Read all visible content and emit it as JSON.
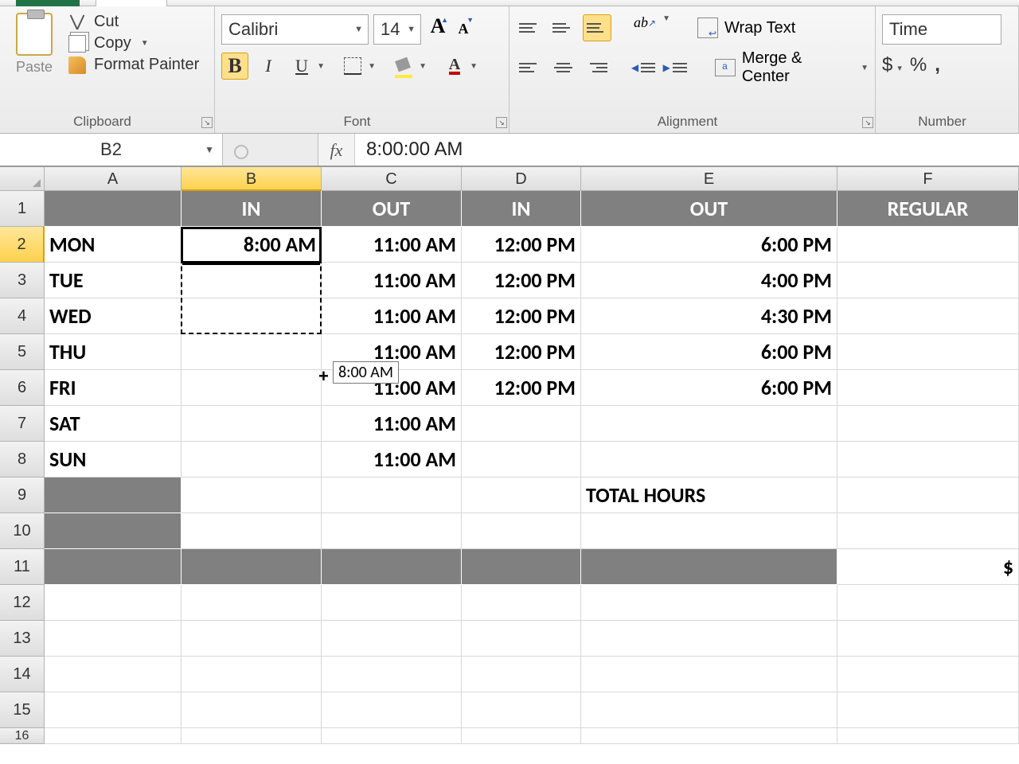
{
  "ribbon": {
    "clipboard": {
      "paste": "Paste",
      "cut": "Cut",
      "copy": "Copy",
      "format_painter": "Format Painter",
      "group_label": "Clipboard"
    },
    "font": {
      "name": "Calibri",
      "size": "14",
      "group_label": "Font"
    },
    "alignment": {
      "wrap": "Wrap Text",
      "merge": "Merge & Center",
      "group_label": "Alignment"
    },
    "number": {
      "format": "Time",
      "currency": "$",
      "percent": "%",
      "comma": ",",
      "group_label": "Number"
    }
  },
  "namebox": "B2",
  "formula": "8:00:00 AM",
  "columns": [
    "A",
    "B",
    "C",
    "D",
    "E",
    "F"
  ],
  "headers": {
    "B": "IN",
    "C": "OUT",
    "D": "IN",
    "E": "OUT",
    "F": "REGULAR"
  },
  "rows": [
    {
      "A": "MON",
      "B": "8:00 AM",
      "C": "11:00 AM",
      "D": "12:00 PM",
      "E": "6:00 PM"
    },
    {
      "A": "TUE",
      "B": "",
      "C": "11:00 AM",
      "D": "12:00 PM",
      "E": "4:00 PM"
    },
    {
      "A": "WED",
      "B": "",
      "C": "11:00 AM",
      "D": "12:00 PM",
      "E": "4:30 PM"
    },
    {
      "A": "THU",
      "B": "",
      "C": "11:00 AM",
      "D": "12:00 PM",
      "E": "6:00 PM"
    },
    {
      "A": "FRI",
      "B": "",
      "C": "11:00 AM",
      "D": "12:00 PM",
      "E": "6:00 PM"
    },
    {
      "A": "SAT",
      "B": "",
      "C": "11:00 AM",
      "D": "",
      "E": ""
    },
    {
      "A": "SUN",
      "B": "",
      "C": "11:00 AM",
      "D": "",
      "E": ""
    }
  ],
  "total_label": "TOTAL HOURS",
  "row11_F": "$",
  "drag_tooltip": "8:00 AM"
}
